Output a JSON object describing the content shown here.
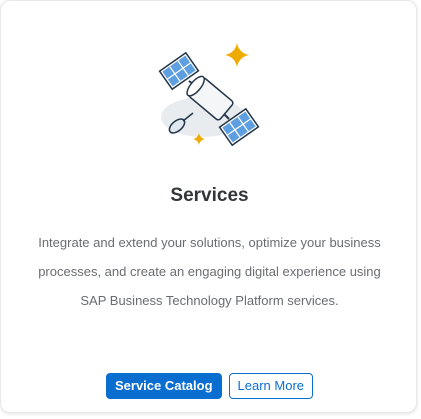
{
  "card": {
    "icon": "satellite-illustration",
    "title": "Services",
    "description_lines": [
      "Integrate and extend your solutions, optimize your business",
      "processes, and create an engaging digital experience using",
      "SAP Business Technology Platform services."
    ],
    "primary_button": "Service Catalog",
    "secondary_button": "Learn More"
  },
  "colors": {
    "accent": "#0a6ed1",
    "sparkle": "#f0ab00",
    "title_text": "#32363a",
    "body_text": "#6a6d70"
  }
}
